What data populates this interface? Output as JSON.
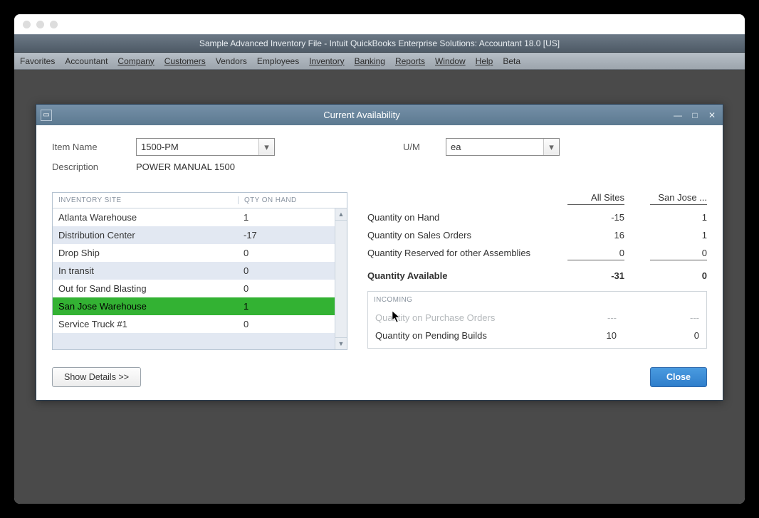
{
  "app_title": "Sample Advanced Inventory File  - Intuit QuickBooks Enterprise Solutions: Accountant 18.0 [US]",
  "menubar": {
    "items": [
      "Favorites",
      "Accountant",
      "Company",
      "Customers",
      "Vendors",
      "Employees",
      "Inventory",
      "Banking",
      "Reports",
      "Window",
      "Help",
      "Beta"
    ]
  },
  "dialog": {
    "title": "Current Availability",
    "labels": {
      "item_name": "Item Name",
      "description": "Description",
      "um": "U/M",
      "show_details": "Show Details >>",
      "close": "Close"
    },
    "item_name_value": "1500-PM",
    "description_value": "POWER MANUAL 1500",
    "um_value": "ea",
    "grid": {
      "headers": {
        "site": "INVENTORY SITE",
        "qty": "QTY ON HAND"
      },
      "rows": [
        {
          "site": "Atlanta Warehouse",
          "qty": "1"
        },
        {
          "site": "Distribution Center",
          "qty": "-17"
        },
        {
          "site": "Drop Ship",
          "qty": "0"
        },
        {
          "site": "In transit",
          "qty": "0"
        },
        {
          "site": "Out for Sand Blasting",
          "qty": "0"
        },
        {
          "site": "San Jose Warehouse",
          "qty": "1",
          "selected": true
        },
        {
          "site": "Service Truck #1",
          "qty": "0"
        },
        {
          "site": "",
          "qty": ""
        }
      ]
    },
    "columns": {
      "all_sites": "All Sites",
      "selected_site": "San Jose ..."
    },
    "metrics": {
      "qty_on_hand": {
        "label": "Quantity on Hand",
        "all": "-15",
        "sel": "1"
      },
      "qty_on_so": {
        "label": "Quantity on Sales Orders",
        "all": "16",
        "sel": "1"
      },
      "qty_reserved": {
        "label": "Quantity Reserved for other Assemblies",
        "all": "0",
        "sel": "0"
      },
      "qty_avail": {
        "label": "Quantity Available",
        "all": "-31",
        "sel": "0"
      }
    },
    "incoming": {
      "header": "INCOMING",
      "po": {
        "label": "Quantity on Purchase Orders",
        "all": "---",
        "sel": "---"
      },
      "pb": {
        "label": "Quantity on Pending Builds",
        "all": "10",
        "sel": "0"
      }
    }
  }
}
